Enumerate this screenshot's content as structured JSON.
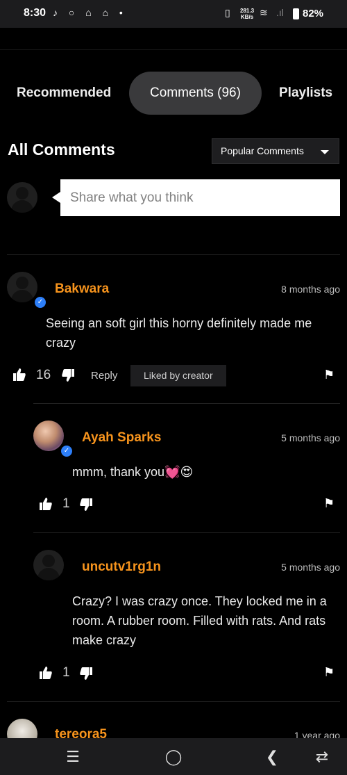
{
  "status_bar": {
    "time": "8:30",
    "left_icons": "♪ ○ ⌂ ⌂ •",
    "net_speed_top": "281.3",
    "net_speed_bottom": "KB/s",
    "right_icons": "▯ ≋ .ıl",
    "battery": "82%"
  },
  "tabs": [
    {
      "label": "Recommended",
      "active": false
    },
    {
      "label": "Comments (96)",
      "active": true
    },
    {
      "label": "Playlists",
      "active": false
    }
  ],
  "comments_header": {
    "title": "All Comments",
    "sort_selected": "Popular Comments"
  },
  "composer": {
    "placeholder": "Share what you think"
  },
  "comments": [
    {
      "author": "Bakwara",
      "time": "8 months ago",
      "text": "Seeing an soft girl this horny definitely made me crazy",
      "likes": "16",
      "reply_label": "Reply",
      "liked_badge": "Liked by creator"
    },
    {
      "author": "Ayah Sparks",
      "time": "5 months ago",
      "text": "mmm, thank you💓😍",
      "likes": "1"
    },
    {
      "author": "uncutv1rg1n",
      "time": "5 months ago",
      "text": "Crazy? I was crazy once. They locked me in a room. A rubber room. Filled with rats. And rats make crazy",
      "likes": "1"
    },
    {
      "author": "tereora5",
      "time": "1 year ago"
    }
  ],
  "colors": {
    "author": "#f7941d",
    "verified": "#2d7ff9",
    "background": "#000000"
  }
}
